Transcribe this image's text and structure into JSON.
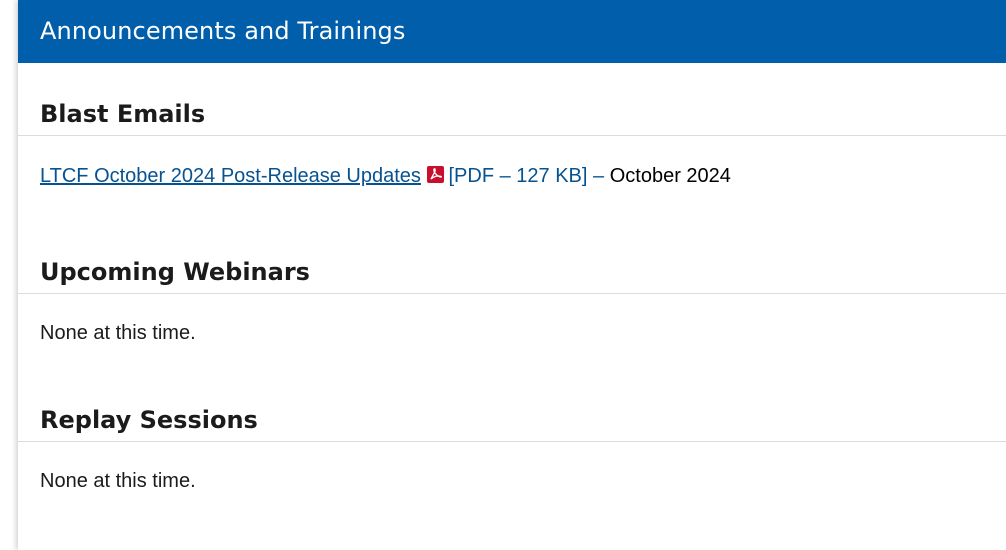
{
  "header": {
    "title": "Announcements and Trainings"
  },
  "sections": [
    {
      "title": "Blast Emails",
      "item": {
        "link_text": "LTCF October 2024 Post-Release Updates",
        "file_meta": "[PDF – 127 KB]",
        "separator": "–",
        "date": "October 2024",
        "icon": "pdf-icon"
      }
    },
    {
      "title": "Upcoming Webinars",
      "body": "None at this time."
    },
    {
      "title": "Replay Sessions",
      "body": "None at this time."
    }
  ],
  "colors": {
    "header_bg": "#005eaa",
    "link": "#075290",
    "pdf_icon": "#c8102e",
    "divider": "#dcdcdc"
  }
}
